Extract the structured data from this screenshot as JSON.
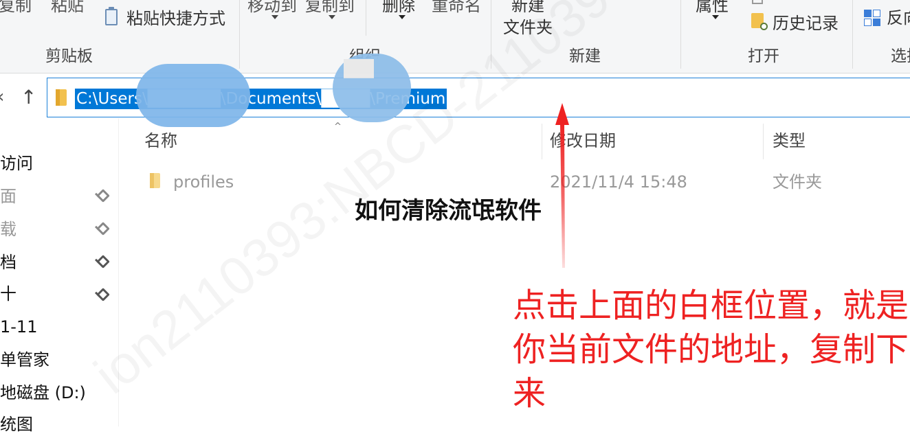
{
  "ribbon": {
    "clipboard": {
      "copy_label": "复制",
      "paste_label": "粘贴",
      "paste_shortcut_label": "粘贴快捷方式",
      "group_label": "剪贴板"
    },
    "organize": {
      "move_to_label": "移动到",
      "copy_to_label": "复制到",
      "delete_label": "删除",
      "rename_label": "重命名",
      "group_label": "组织"
    },
    "new": {
      "new_folder_label_line1": "新建",
      "new_folder_label_line2": "文件夹",
      "group_label": "新建"
    },
    "open": {
      "properties_label": "属性",
      "history_label": "历史记录",
      "group_label": "打开"
    },
    "select": {
      "invert_label": "反向",
      "group_label": "选择"
    }
  },
  "navigation": {
    "back_glyph": "‹",
    "up_glyph": "↑",
    "address_path": "C:\\Users\\██████\\Documents\\████\\Premium"
  },
  "sidebar": {
    "items": [
      {
        "label": "访问",
        "pinned": false
      },
      {
        "label": "面",
        "pinned": true
      },
      {
        "label": "载",
        "pinned": true
      },
      {
        "label": "档",
        "pinned": true
      },
      {
        "label": "十",
        "pinned": true
      },
      {
        "label": "1-11",
        "pinned": false
      },
      {
        "label": "单管家",
        "pinned": false
      },
      {
        "label": "地磁盘 (D:)",
        "pinned": false
      },
      {
        "label": "统图",
        "pinned": false
      }
    ]
  },
  "file_list": {
    "columns": {
      "name": "名称",
      "modified": "修改日期",
      "type": "类型"
    },
    "sort_glyph": "^",
    "rows": [
      {
        "name": "profiles",
        "modified": "2021/11/4 15:48",
        "type": "文件夹"
      }
    ]
  },
  "overlay": {
    "title": "如何清除流氓软件",
    "annotation": "点击上面的白框位置，就是你当前文件的地址，复制下来",
    "annotation_color": "#ee2222"
  },
  "watermark": {
    "text": "ion2110393:NBCD-2110393"
  },
  "colors": {
    "ribbon_bg": "#f5f6f7",
    "selection_blue": "#0078d7",
    "folder_yellow": "#f2c14e",
    "address_border": "#1a7fd9"
  }
}
